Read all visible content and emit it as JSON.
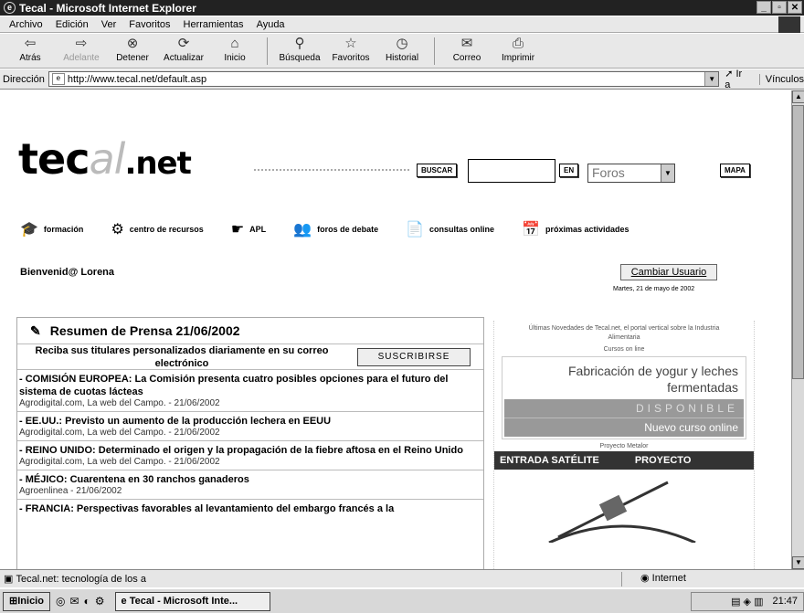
{
  "window": {
    "title": "Tecal - Microsoft Internet Explorer"
  },
  "menu": [
    "Archivo",
    "Edición",
    "Ver",
    "Favoritos",
    "Herramientas",
    "Ayuda"
  ],
  "toolbar": [
    {
      "label": "Atrás",
      "icon": "back-arrow-icon",
      "glyph": "⇦"
    },
    {
      "label": "Adelante",
      "icon": "forward-arrow-icon",
      "glyph": "⇨",
      "disabled": true
    },
    {
      "label": "Detener",
      "icon": "stop-icon",
      "glyph": "⊗"
    },
    {
      "label": "Actualizar",
      "icon": "refresh-icon",
      "glyph": "⟳"
    },
    {
      "label": "Inicio",
      "icon": "home-icon",
      "glyph": "⌂"
    },
    {
      "label": "Búsqueda",
      "icon": "search-icon",
      "glyph": "⚲"
    },
    {
      "label": "Favoritos",
      "icon": "favorites-icon",
      "glyph": "☆"
    },
    {
      "label": "Historial",
      "icon": "history-icon",
      "glyph": "◷"
    },
    {
      "label": "Correo",
      "icon": "mail-icon",
      "glyph": "✉"
    },
    {
      "label": "Imprimir",
      "icon": "print-icon",
      "glyph": "⎙"
    }
  ],
  "address": {
    "label": "Dirección",
    "url": "http://www.tecal.net/default.asp",
    "go": "Ir a",
    "links": "Vínculos"
  },
  "site": {
    "logo": {
      "part1": "tec",
      "part2": "al",
      "part3": ".net"
    },
    "search_button": "BUSCAR",
    "en_button": "EN",
    "foros_value": "Foros",
    "map_button": "MAPA",
    "nav": [
      {
        "label": "formación",
        "icon": "graduation-cap-icon",
        "glyph": "🎓"
      },
      {
        "label": "centro de recursos",
        "icon": "gear-icon",
        "glyph": "⚙"
      },
      {
        "label": "APL",
        "icon": "hand-icon",
        "glyph": "☛"
      },
      {
        "label": "foros de debate",
        "icon": "people-icon",
        "glyph": "👥"
      },
      {
        "label": "consultas online",
        "icon": "document-icon",
        "glyph": "📄"
      },
      {
        "label": "próximas actividades",
        "icon": "calendar-icon",
        "glyph": "📅"
      }
    ],
    "welcome": "Bienvenid@ Lorena",
    "change_user": "Cambiar Usuario",
    "date": "Martes, 21 de mayo de 2002"
  },
  "press": {
    "title": "Resumen de Prensa 21/06/2002",
    "subscribe_text": "Reciba sus titulares personalizados diariamente en su correo electrónico",
    "subscribe_button": "SUSCRIBIRSE",
    "items": [
      {
        "headline": "- COMISIÓN EUROPEA: La Comisión presenta cuatro posibles opciones para el futuro del sistema de cuotas lácteas",
        "source": "Agrodigital.com, La web del Campo. - 21/06/2002"
      },
      {
        "headline": "- EE.UU.: Previsto un aumento de la producción lechera en EEUU",
        "source": "Agrodigital.com, La web del Campo. - 21/06/2002"
      },
      {
        "headline": "- REINO UNIDO: Determinado el origen y la propagación de la fiebre aftosa en el Reino Unido",
        "source": "Agrodigital.com, La web del Campo. - 21/06/2002"
      },
      {
        "headline": "- MÉJICO: Cuarentena en 30 ranchos ganaderos",
        "source": "Agroenlinea - 21/06/2002"
      },
      {
        "headline": "- FRANCIA: Perspectivas favorables al levantamiento del embargo francés a la",
        "source": ""
      }
    ]
  },
  "sidebar": {
    "intro": "Últimas Novedades de Tecal.net, el portal vertical sobre la Industria Alimentaria",
    "cursos_label": "Cursos on line",
    "course_title": "Fabricación de yogur y leches fermentadas",
    "disponible": "DISPONIBLE",
    "nuevo": "Nuevo curso online",
    "proyecto_label": "Proyecto Metalor",
    "entrada": "ENTRADA SATÉLITE",
    "proyecto": "PROYECTO"
  },
  "status": {
    "text": "Tecal.net: tecnología de los a",
    "zone": "Internet"
  },
  "taskbar": {
    "start": "Inicio",
    "task": "Tecal - Microsoft Inte...",
    "clock": "21:47"
  }
}
